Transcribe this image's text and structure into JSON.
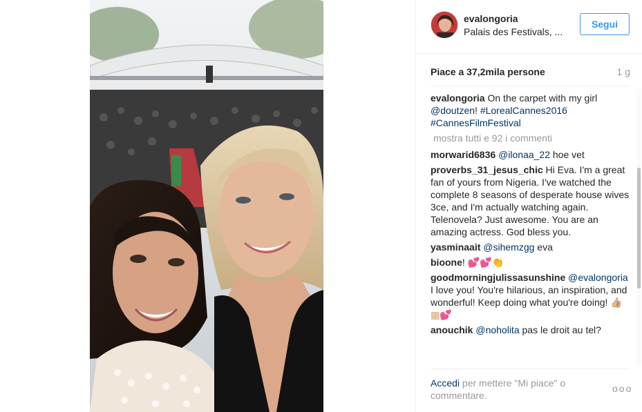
{
  "post": {
    "username": "evalongoria",
    "location": "Palais des Festivals, ...",
    "follow_label": "Segui",
    "likes_text": "Piace a 37,2mila persone",
    "time_ago": "1 g"
  },
  "caption": {
    "username": "evalongoria",
    "text_before": " On the carpet with my girl ",
    "mention": "@doutzen",
    "text_mid": "! ",
    "hashtag1": "#LorealCannes2016",
    "hashtag2": "#CannesFilmFestival"
  },
  "load_more": "mostra tutti e 92 i commenti",
  "comments": [
    {
      "username": "morwarid6836",
      "mention": "@ilonaa_22",
      "text": " hoe vet"
    },
    {
      "username": "proverbs_31_jesus_chic",
      "mention": "",
      "text": " Hi Eva. I'm a great fan of yours from Nigeria. I've watched the complete 8 seasons of desperate house wives 3ce, and I'm actually watching again. Telenovela? Just awesome. You are an amazing actress. God bless you."
    },
    {
      "username": "yasminaait",
      "mention": "@sihemzgg",
      "text": " eva"
    },
    {
      "username": "bioone",
      "mention": "",
      "text": "!",
      "emoji": "💕💕👏"
    },
    {
      "username": "goodmorningjulissasunshine",
      "mention": "@evalongoria",
      "text": " I love you! You're hilarious, an inspiration, and wonderful! Keep doing what you're doing! ",
      "emoji": "👍🏼▦💕"
    },
    {
      "username": "anouchik",
      "mention": "@noholita",
      "text": " pas le droit au tel?"
    }
  ],
  "footer": {
    "login_link": "Accedi",
    "text": " per mettere \"Mi piace\" o commentare."
  },
  "more_options": "ooo",
  "colors": {
    "accent": "#3897f0",
    "link": "#003569",
    "muted": "#999999"
  }
}
